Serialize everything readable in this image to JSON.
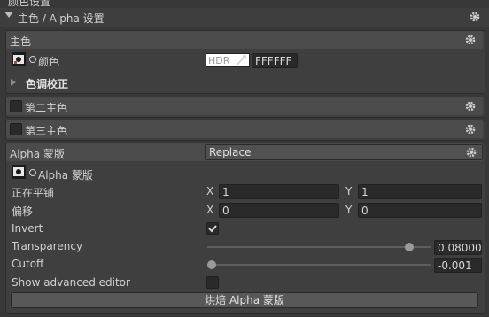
{
  "window": {
    "title": "颜色设置"
  },
  "main_color_settings": {
    "header": "主色 / Alpha 设置"
  },
  "main_color": {
    "title": "主色",
    "color_label": "颜色",
    "hdr_label": "HDR",
    "hex_value": "FFFFFF",
    "hue_correction": "色调校正"
  },
  "second_color": {
    "title": "第二主色"
  },
  "third_color": {
    "title": "第三主色"
  },
  "alpha_mask": {
    "title": "Alpha 蒙版",
    "mode_value": "Replace",
    "texture_label": "Alpha 蒙版",
    "tiling_label": "正在平铺",
    "offset_label": "偏移",
    "x_label": "X",
    "y_label": "Y",
    "tiling_x": "1",
    "tiling_y": "1",
    "offset_x": "0",
    "offset_y": "0",
    "invert_label": "Invert",
    "invert_checked": true,
    "transparency_label": "Transparency",
    "transparency_value": "0.08000",
    "transparency_fraction": 0.92,
    "cutoff_label": "Cutoff",
    "cutoff_value": "-0.001",
    "cutoff_fraction": 0.0,
    "advanced_label": "Show advanced editor",
    "advanced_checked": false,
    "bake_button": "烘焙 Alpha 蒙版"
  },
  "colors": {
    "background": "#383838",
    "section_bar": "#4b4b4b",
    "field": "#2a2a2a",
    "text": "#d2d2d2"
  }
}
